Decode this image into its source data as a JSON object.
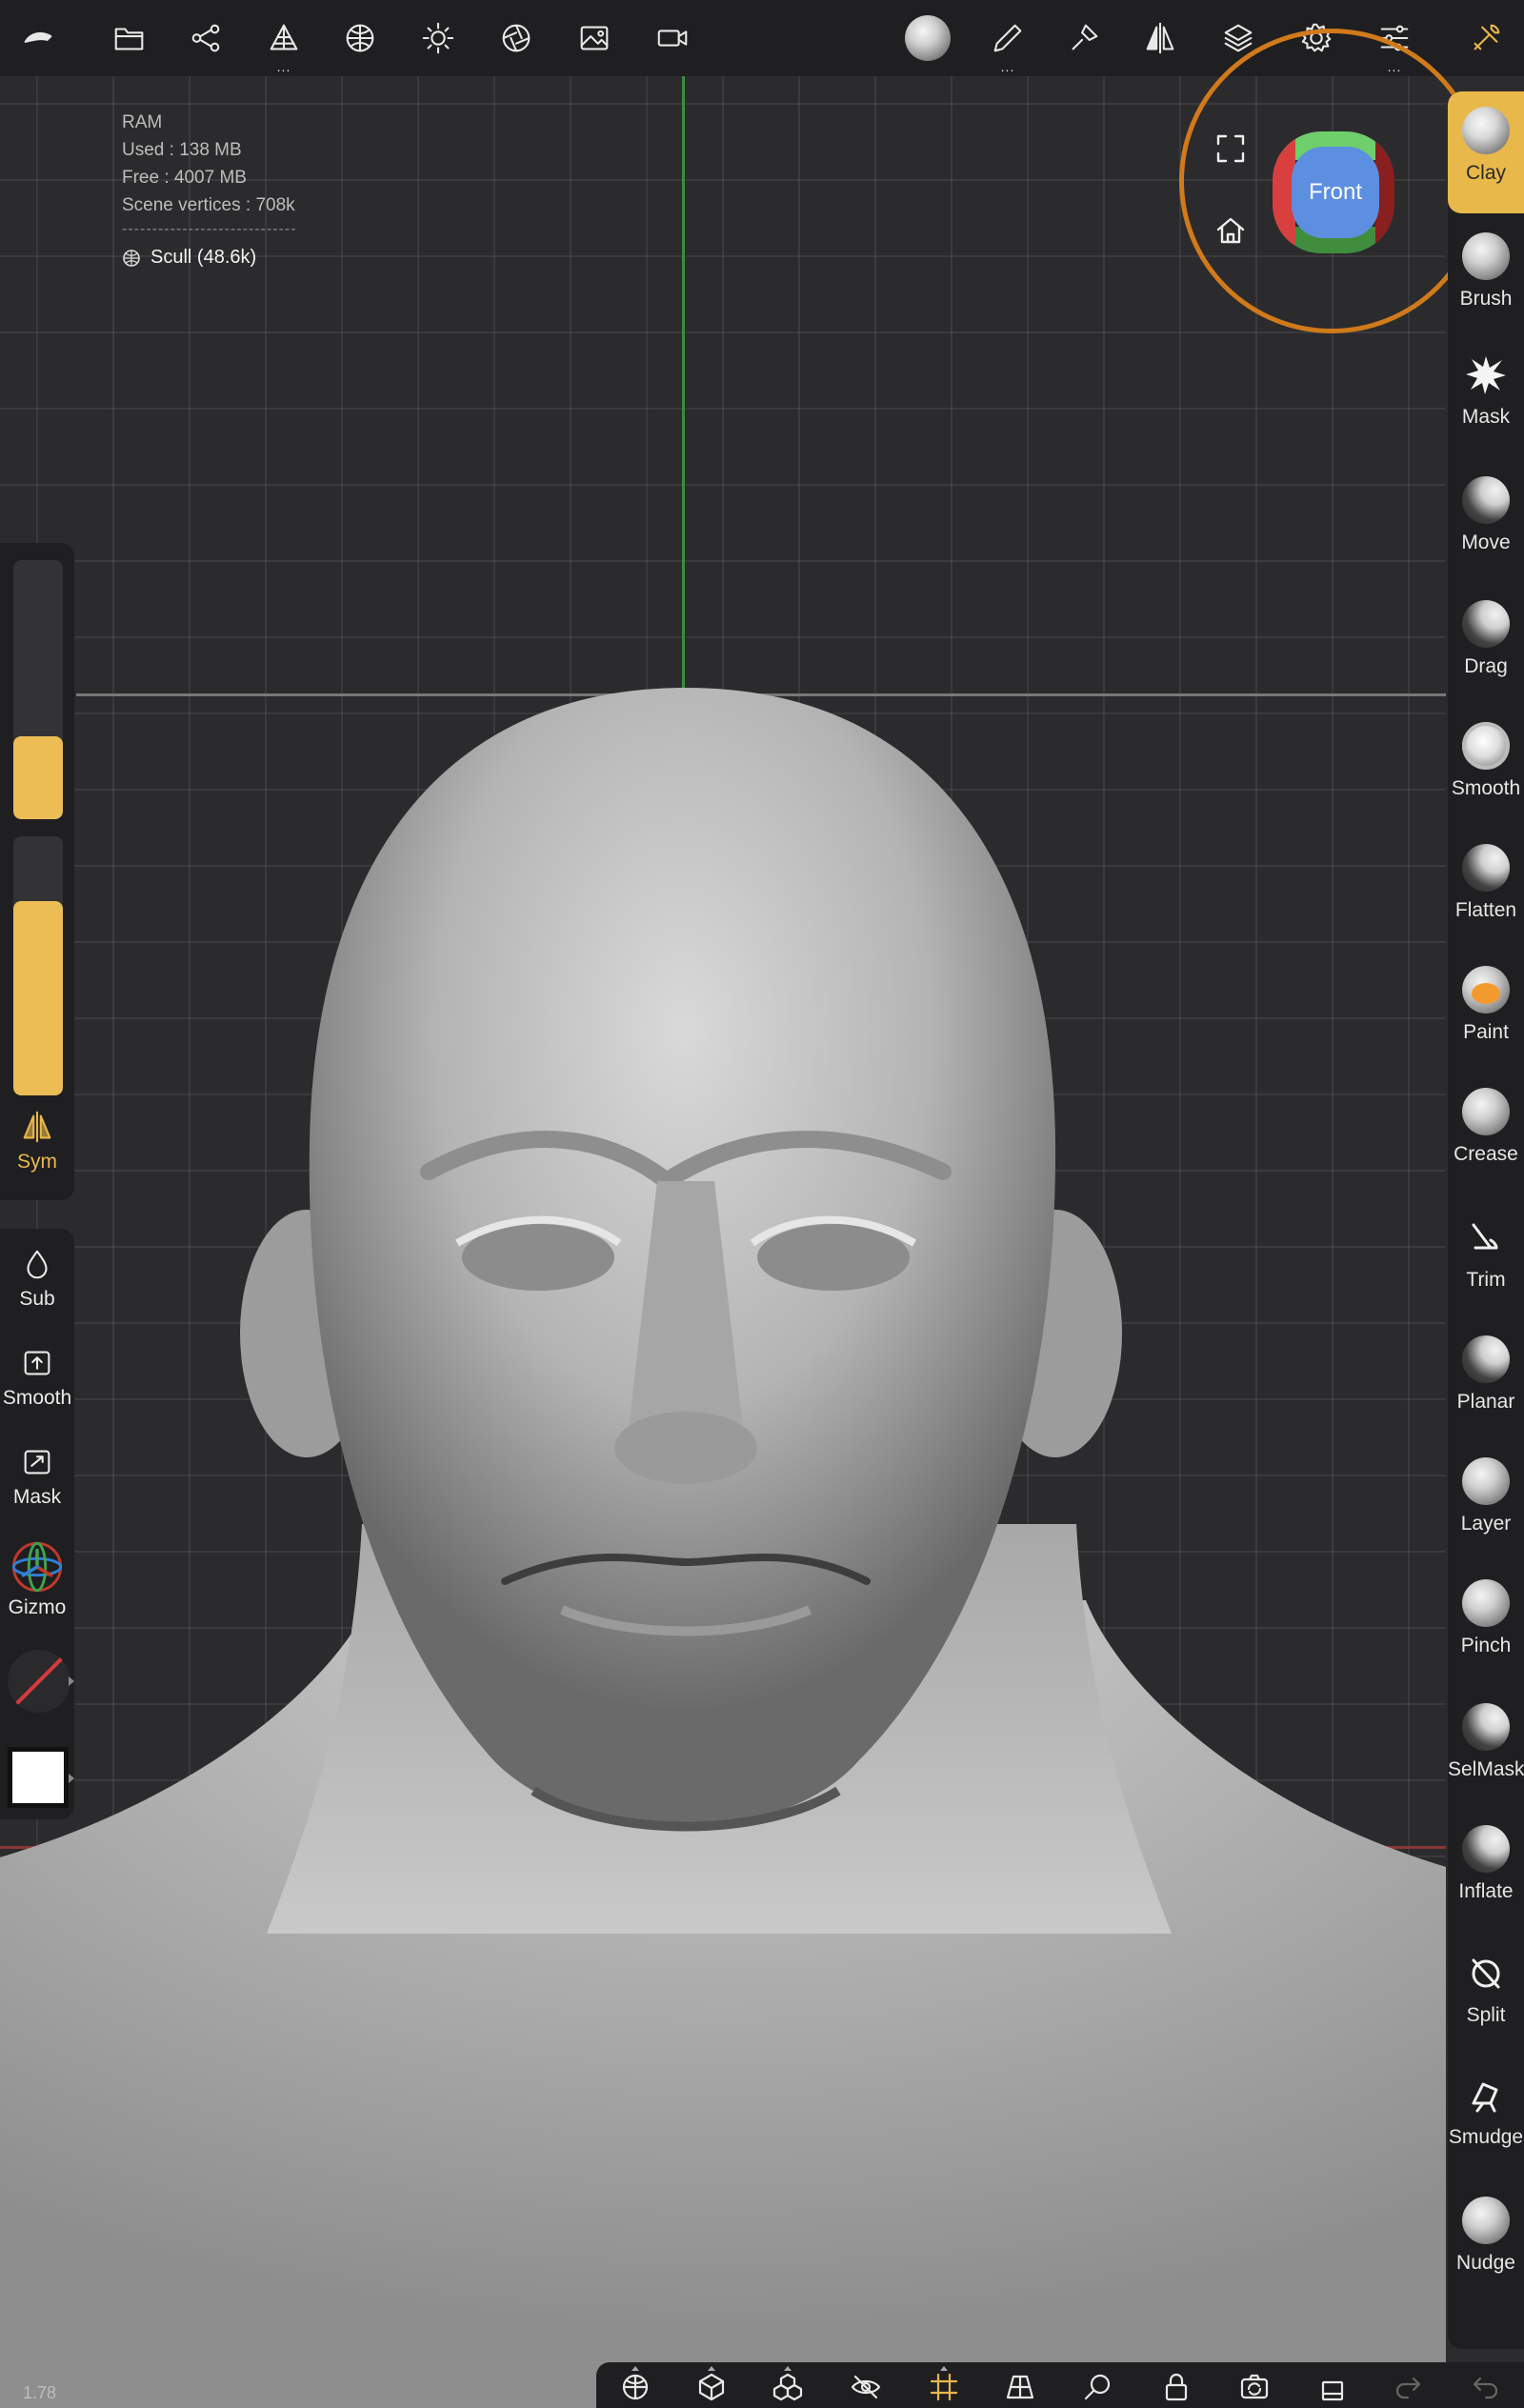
{
  "info": {
    "title": "RAM",
    "used": "Used : 138 MB",
    "free": "Free : 4007 MB",
    "vertices": "Scene vertices : 708k",
    "separator": "-----------------------------",
    "mesh": "Scull (48.6k)"
  },
  "view_cube": {
    "face": "Front"
  },
  "left_panel": {
    "radius_fraction": 0.32,
    "intensity_fraction": 0.75,
    "sym": "Sym",
    "sub": "Sub",
    "smooth": "Smooth",
    "mask": "Mask",
    "gizmo": "Gizmo"
  },
  "tools": [
    {
      "label": "Clay",
      "icon": "clay-brush-icon"
    },
    {
      "label": "Brush",
      "icon": "brush-icon"
    },
    {
      "label": "Mask",
      "icon": "mask-splat-icon"
    },
    {
      "label": "Move",
      "icon": "move-brush-icon"
    },
    {
      "label": "Drag",
      "icon": "drag-brush-icon"
    },
    {
      "label": "Smooth",
      "icon": "smooth-brush-icon"
    },
    {
      "label": "Flatten",
      "icon": "flatten-brush-icon"
    },
    {
      "label": "Paint",
      "icon": "paint-brush-icon"
    },
    {
      "label": "Crease",
      "icon": "crease-brush-icon"
    },
    {
      "label": "Trim",
      "icon": "trim-icon"
    },
    {
      "label": "Planar",
      "icon": "planar-brush-icon"
    },
    {
      "label": "Layer",
      "icon": "layer-brush-icon"
    },
    {
      "label": "Pinch",
      "icon": "pinch-brush-icon"
    },
    {
      "label": "SelMask",
      "icon": "selmask-icon"
    },
    {
      "label": "Inflate",
      "icon": "inflate-brush-icon"
    },
    {
      "label": "Split",
      "icon": "split-icon"
    },
    {
      "label": "Smudge",
      "icon": "smudge-icon"
    },
    {
      "label": "Nudge",
      "icon": "nudge-brush-icon"
    }
  ],
  "zoom": "1.78",
  "colors": {
    "accent": "#e9b84a",
    "orbit_ring": "#d07a1c",
    "axis_green": "#3e8a3e",
    "axis_red": "#8a3636"
  }
}
